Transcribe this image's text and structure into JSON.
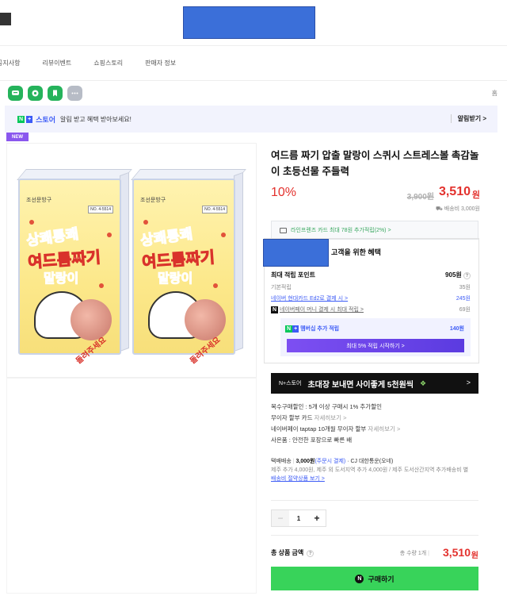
{
  "nav": {
    "items": [
      "공지사항",
      "리뷰이벤트",
      "쇼핑스토리",
      "판매자 정보"
    ]
  },
  "share": {
    "icons": [
      "chat-icon",
      "talk-icon",
      "bookmark-icon",
      "more-icon"
    ],
    "edge_char": "홈"
  },
  "alarm": {
    "store_label": "스토어",
    "text": "알림 받고 혜택 받아보세요!",
    "button": "알림받기 >"
  },
  "badge": {
    "new": "NEW"
  },
  "product_image": {
    "brand": "조선문방구",
    "info": "NO. 4-5514",
    "title_line1": "상쾌통쾌",
    "title_line2": "여드름짜기",
    "title_line3": "말랑이",
    "arrow_text": "돌려주세요"
  },
  "product": {
    "title": "여드름 짜기 압출 말랑이 스퀴시 스트레스볼 촉감놀이 초등선물 주들력",
    "discount": "10%",
    "original_price": "3,900원",
    "sale_price": "3,510",
    "price_unit": "원",
    "shipping_note": "배송비 3,000원",
    "card_benefit": "라인프렌즈 카드 최대 78원 추가적립(2%) >"
  },
  "benefit": {
    "title": "고객을 위한 혜택",
    "max_points_label": "최대 적립 포인트",
    "max_points_value": "905원",
    "rows": [
      {
        "label": "기본적립",
        "value": "35원"
      },
      {
        "label": "네이버 현대카드 Ed2로 결제 시 >",
        "value": "245원"
      },
      {
        "label": "네이버페이 머니 결제 시 최대 적립 >",
        "value": "69원"
      }
    ],
    "membership_label": "멤버십 추가 적립",
    "membership_value": "140원",
    "membership_button": "최대 5% 적립 시작하기 >"
  },
  "promo_banner": {
    "logo": "N+스토어",
    "text": "초대장 보내면 사이좋게 5천원씩",
    "arrow": ">"
  },
  "info_lines": [
    {
      "text": "복수구매할인 : 5개 이상 구매시 1% 추가할인",
      "more": ""
    },
    {
      "text": "무이자 할부 카드 ",
      "more": "자세히보기 >"
    },
    {
      "text": "네이버페이 taptap 10개월 무이자 할부 ",
      "more": "자세히보기 >"
    },
    {
      "text": "사은품 : 안전한 포장으로 빠른 배",
      "more": ""
    }
  ],
  "delivery": {
    "label": "택배배송",
    "fee": "3,000원",
    "fee_note": "(주문시 결제)",
    "carrier": "· CJ 대한통운(오네)",
    "extra": "제주 추가 4,000원, 제주 외 도서지역 추가 4,000원 / 제주 도서산간지역 추가배송비 별",
    "link": "배송비 절약상품 보기 >"
  },
  "quantity": {
    "minus": "−",
    "value": "1",
    "plus": "+"
  },
  "total": {
    "label": "총 상품 금액",
    "help": "?",
    "qty_text": "총 수량 1개",
    "price": "3,510",
    "unit": "원"
  },
  "buy": {
    "n": "N",
    "label": "구매하기"
  }
}
